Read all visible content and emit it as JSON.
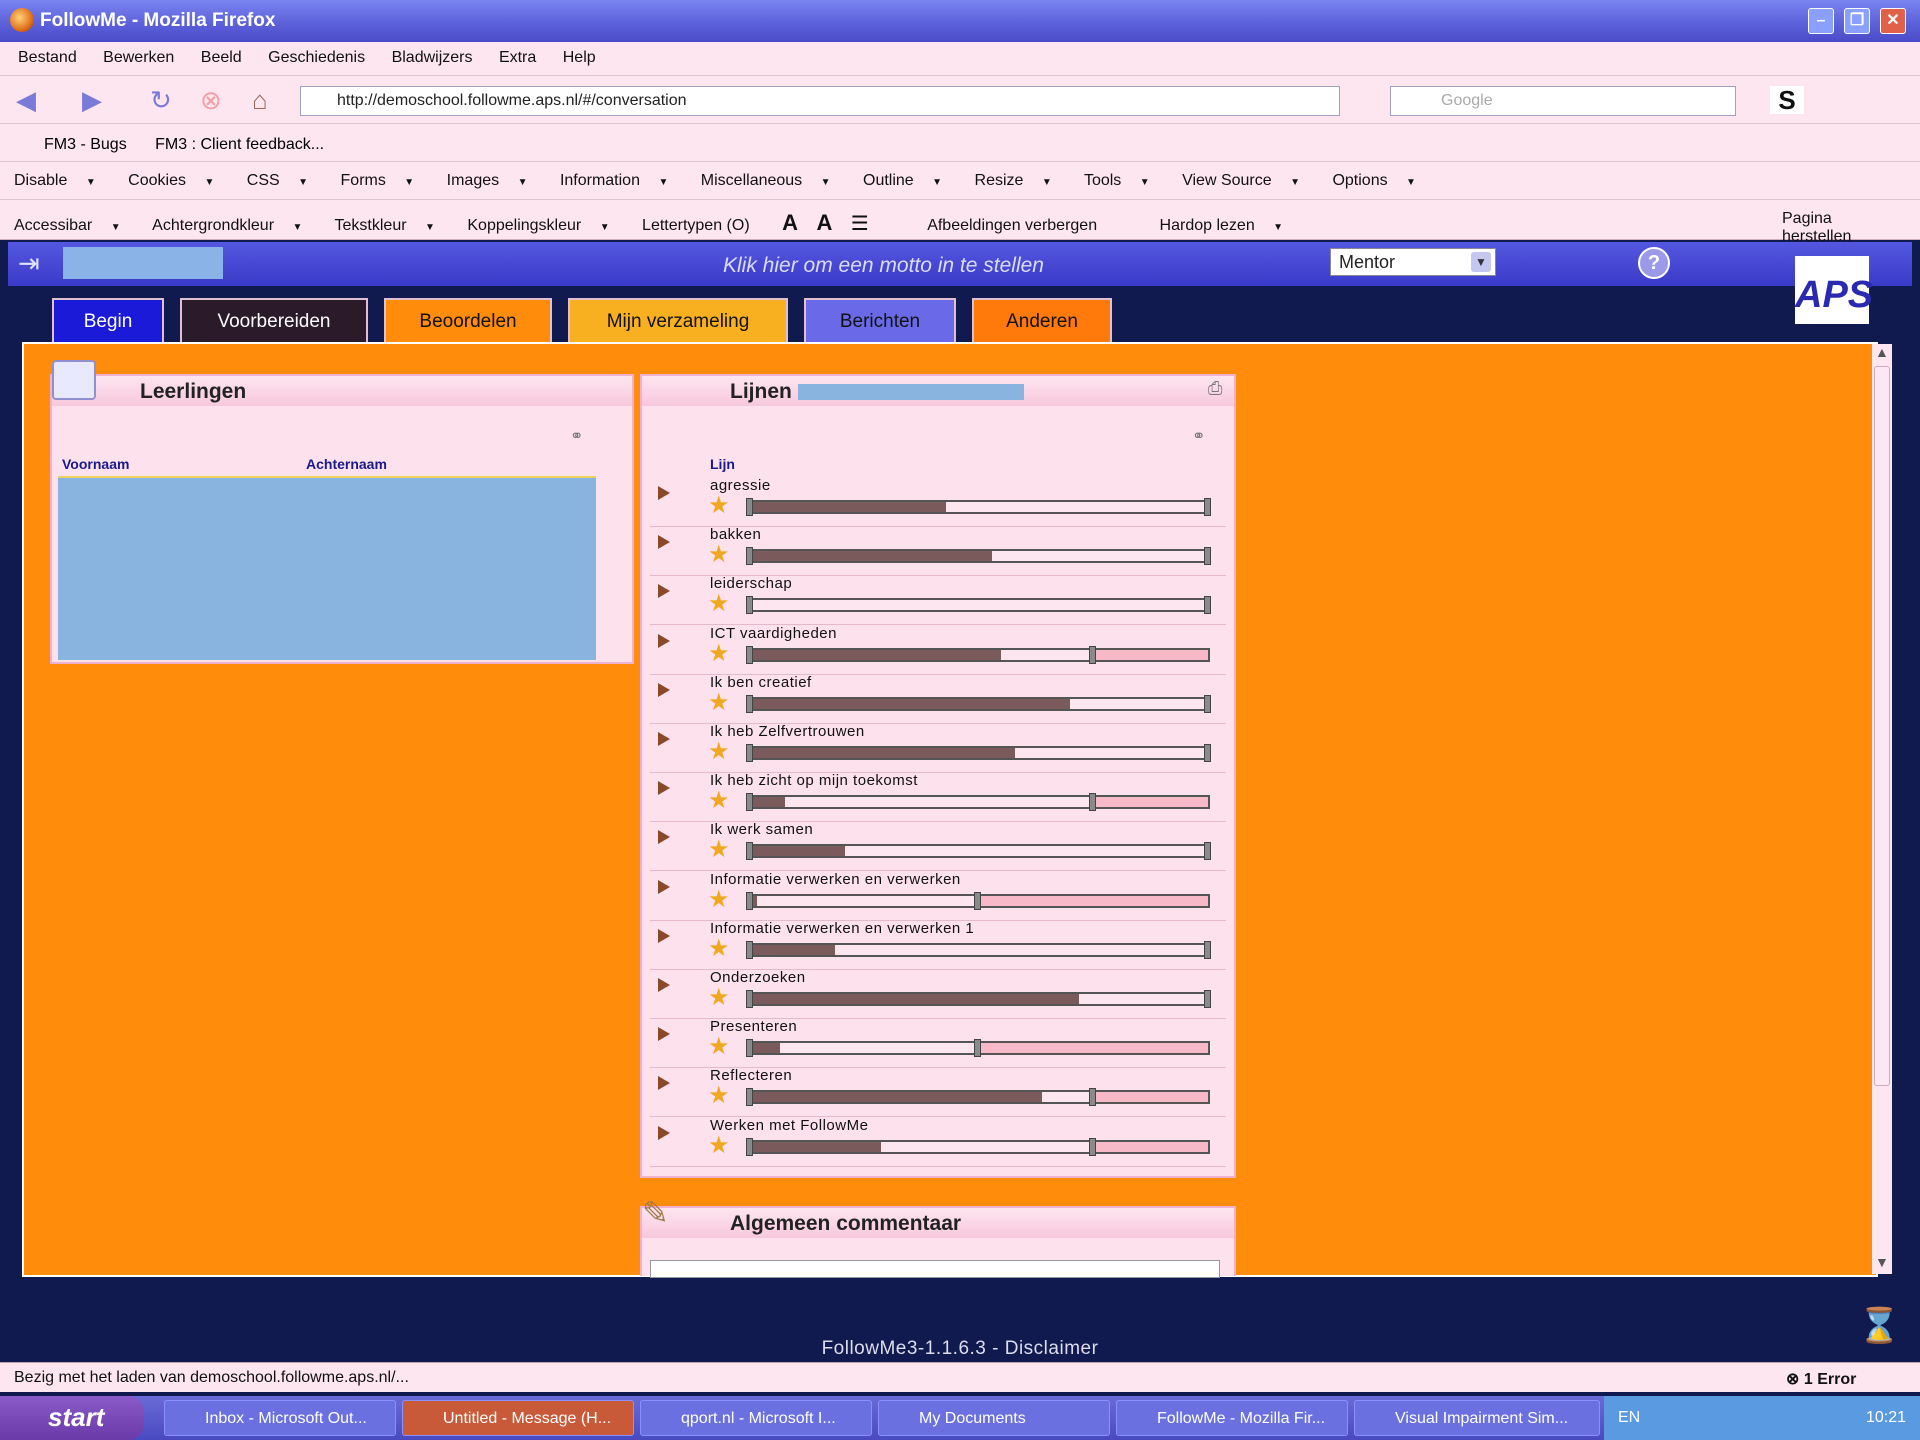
{
  "window": {
    "title": "FollowMe - Mozilla Firefox"
  },
  "menu": [
    "Bestand",
    "Bewerken",
    "Beeld",
    "Geschiedenis",
    "Bladwijzers",
    "Extra",
    "Help"
  ],
  "nav": {
    "url": "http://demoschool.followme.aps.nl/#/conversation",
    "search_placeholder": "Google"
  },
  "bookmarks": [
    "FM3 - Bugs",
    "FM3 : Client feedback..."
  ],
  "devtools": [
    "Disable",
    "Cookies",
    "CSS",
    "Forms",
    "Images",
    "Information",
    "Miscellaneous",
    "Outline",
    "Resize",
    "Tools",
    "View Source",
    "Options"
  ],
  "accessbar": [
    "Accessibar",
    "Achtergrondkleur",
    "Tekstkleur",
    "Koppelingskleur",
    "Lettertypen (O)",
    "Afbeeldingen verbergen",
    "Hardop lezen",
    "Pagina herstellen"
  ],
  "app": {
    "motto": "Klik hier om een motto in te stellen",
    "role": "Mentor",
    "logo": "APS"
  },
  "tabs": [
    {
      "label": "Begin",
      "bg": "#1a1ad8",
      "color": "#ffffff"
    },
    {
      "label": "Voorbereiden",
      "bg": "#2a1a2a",
      "color": "#ffffff"
    },
    {
      "label": "Beoordelen",
      "bg": "#ff8c0a",
      "color": "#111111"
    },
    {
      "label": "Mijn verzameling",
      "bg": "#f8b020",
      "color": "#111111"
    },
    {
      "label": "Berichten",
      "bg": "#6a6ae8",
      "color": "#111111"
    },
    {
      "label": "Anderen",
      "bg": "#ff7a0a",
      "color": "#111111"
    }
  ],
  "students": {
    "title": "Leerlingen",
    "col_first": "Voornaam",
    "col_last": "Achternaam"
  },
  "lines": {
    "title": "Lijnen",
    "col": "Lijn",
    "items": [
      {
        "label": "agressie",
        "fill": 0.43,
        "tick": null
      },
      {
        "label": "bakken",
        "fill": 0.53,
        "tick": null
      },
      {
        "label": "leiderschap",
        "fill": 0.0,
        "tick": null
      },
      {
        "label": "ICT vaardigheden",
        "fill": 0.55,
        "tick": 0.75
      },
      {
        "label": "Ik ben creatief",
        "fill": 0.7,
        "tick": null
      },
      {
        "label": "Ik heb Zelfvertrouwen",
        "fill": 0.58,
        "tick": null
      },
      {
        "label": "Ik heb zicht op mijn toekomst",
        "fill": 0.08,
        "tick": 0.75
      },
      {
        "label": "Ik werk samen",
        "fill": 0.21,
        "tick": null
      },
      {
        "label": "Informatie verwerken en verwerken",
        "fill": 0.02,
        "tick": 0.5
      },
      {
        "label": "Informatie verwerken en verwerken 1",
        "fill": 0.19,
        "tick": null
      },
      {
        "label": "Onderzoeken",
        "fill": 0.72,
        "tick": null
      },
      {
        "label": "Presenteren",
        "fill": 0.07,
        "tick": 0.5
      },
      {
        "label": "Reflecteren",
        "fill": 0.64,
        "tick": 0.75
      },
      {
        "label": "Werken met FollowMe",
        "fill": 0.29,
        "tick": 0.75
      }
    ]
  },
  "comment": {
    "title": "Algemeen commentaar"
  },
  "footer": {
    "text": "FollowMe3-1.1.6.3 - Disclaimer"
  },
  "status": {
    "text": "Bezig met het laden van demoschool.followme.aps.nl/...",
    "errors": "1 Error"
  },
  "taskbar": {
    "start": "start",
    "tasks": [
      "Inbox - Microsoft Out...",
      "Untitled - Message (H...",
      "qport.nl - Microsoft I...",
      "My Documents",
      "FollowMe - Mozilla Fir...",
      "Visual Impairment Sim..."
    ],
    "lang": "EN",
    "time": "10:21"
  }
}
